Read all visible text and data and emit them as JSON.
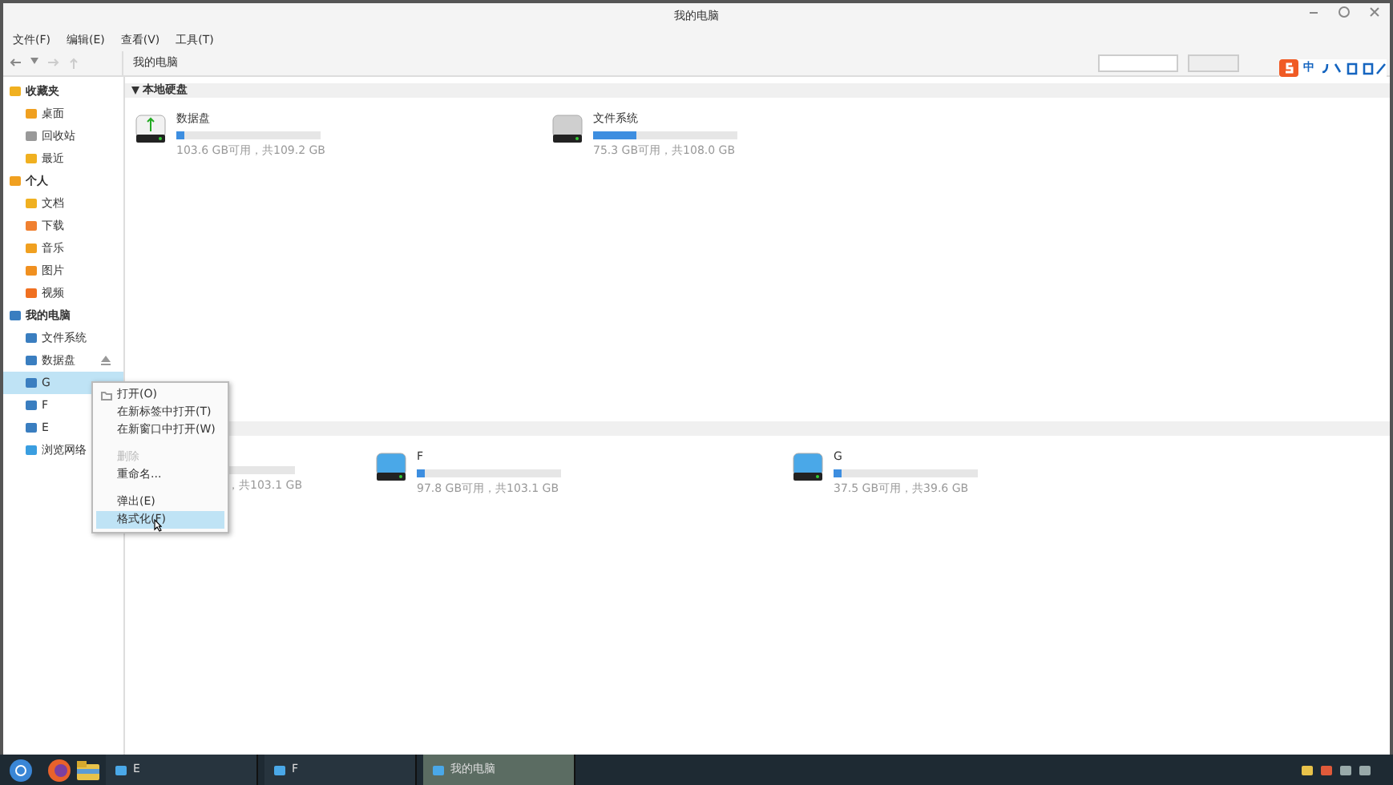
{
  "window": {
    "title": "我的电脑"
  },
  "menu": [
    "文件(F)",
    "编辑(E)",
    "查看(V)",
    "工具(T)"
  ],
  "breadcrumb": "我的电脑",
  "ime": {
    "label": "中"
  },
  "sidebar": [
    {
      "label": "收藏夹",
      "children": [
        {
          "label": "桌面",
          "selected": false
        },
        {
          "label": "回收站",
          "selected": false
        },
        {
          "label": "最近",
          "selected": false
        }
      ]
    },
    {
      "label": "个人",
      "children": [
        {
          "label": "文档",
          "selected": false
        },
        {
          "label": "下载",
          "selected": false
        },
        {
          "label": "音乐",
          "selected": false
        },
        {
          "label": "图片",
          "selected": false
        },
        {
          "label": "视频",
          "selected": false
        }
      ]
    },
    {
      "label": "我的电脑",
      "children": [
        {
          "label": "文件系统",
          "selected": false
        },
        {
          "label": "数据盘",
          "selected": false,
          "eject": true
        },
        {
          "label": "G",
          "selected": true
        },
        {
          "label": "F",
          "selected": false
        },
        {
          "label": "E",
          "selected": false
        },
        {
          "label": "浏览网络",
          "selected": false
        }
      ]
    }
  ],
  "sections": [
    {
      "title": "本地硬盘",
      "drives": [
        {
          "kind": "usb",
          "name": "数据盘",
          "level": 0.05,
          "usage": "103.6 GB可用，共109.2 GB"
        },
        {
          "kind": "hdd",
          "name": "文件系统",
          "level": 0.3,
          "usage": "75.3 GB可用，共108.0 GB"
        }
      ]
    },
    {
      "drives": [
        {
          "kind": "partial",
          "usage": "，共103.1 GB"
        },
        {
          "kind": "removable",
          "name": "F",
          "level": 0.05,
          "usage": "97.8 GB可用，共103.1 GB"
        },
        {
          "kind": "removable",
          "name": "G",
          "level": 0.05,
          "usage": "37.5 GB可用，共39.6 GB"
        }
      ]
    }
  ],
  "context_menu": [
    {
      "kind": "item",
      "label": "打开(O)",
      "icon": true,
      "disabled": false,
      "selected": false
    },
    {
      "kind": "item",
      "label": "在新标签中打开(T)",
      "disabled": false,
      "selected": false
    },
    {
      "kind": "item",
      "label": "在新窗口中打开(W)",
      "disabled": false,
      "selected": false
    },
    {
      "kind": "separator"
    },
    {
      "kind": "item",
      "label": "删除",
      "disabled": true,
      "selected": false
    },
    {
      "kind": "item",
      "label": "重命名...",
      "disabled": false,
      "selected": false
    },
    {
      "kind": "separator"
    },
    {
      "kind": "item",
      "label": "弹出(E)",
      "disabled": false,
      "selected": false
    },
    {
      "kind": "item",
      "label": "格式化(F)",
      "disabled": false,
      "selected": true
    }
  ],
  "taskbar": [
    {
      "label": "E",
      "selected": false
    },
    {
      "label": "F",
      "selected": false
    },
    {
      "label": "我的电脑",
      "selected": true
    }
  ]
}
